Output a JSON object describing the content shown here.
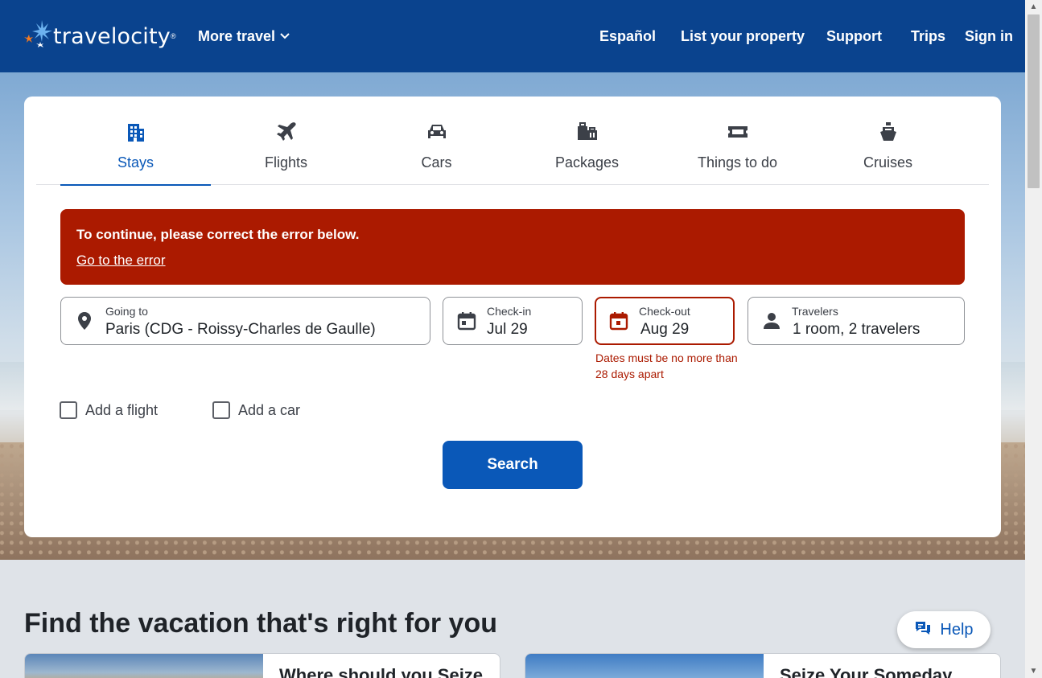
{
  "header": {
    "logo_text": "travelocity",
    "logo_tm": "®",
    "more_travel": "More travel",
    "nav": {
      "espanol": "Español",
      "list_property": "List your property",
      "support": "Support",
      "trips": "Trips",
      "sign_in": "Sign in"
    }
  },
  "tabs": [
    {
      "label": "Stays",
      "icon": "building-icon",
      "active": true
    },
    {
      "label": "Flights",
      "icon": "airplane-icon"
    },
    {
      "label": "Cars",
      "icon": "car-icon"
    },
    {
      "label": "Packages",
      "icon": "luggage-icon"
    },
    {
      "label": "Things to do",
      "icon": "ticket-icon"
    },
    {
      "label": "Cruises",
      "icon": "ship-icon"
    }
  ],
  "error": {
    "title": "To continue, please correct the error below.",
    "link": "Go to the error"
  },
  "fields": {
    "going_to": {
      "label": "Going to",
      "value": "Paris (CDG - Roissy-Charles de Gaulle)"
    },
    "check_in": {
      "label": "Check-in",
      "value": "Jul 29"
    },
    "check_out": {
      "label": "Check-out",
      "value": "Aug 29",
      "error": "Dates must be no more than 28 days apart"
    },
    "travelers": {
      "label": "Travelers",
      "value": "1 room, 2 travelers"
    }
  },
  "options": {
    "add_flight": "Add a flight",
    "add_car": "Add a car"
  },
  "search_label": "Search",
  "lower": {
    "title": "Find the vacation that's right for you",
    "help": "Help",
    "promos": [
      "Where should you Seize",
      "Seize Your Someday"
    ]
  },
  "colors": {
    "header_bg": "#0a438e",
    "accent": "#0a58b8",
    "error": "#ab1a00"
  }
}
